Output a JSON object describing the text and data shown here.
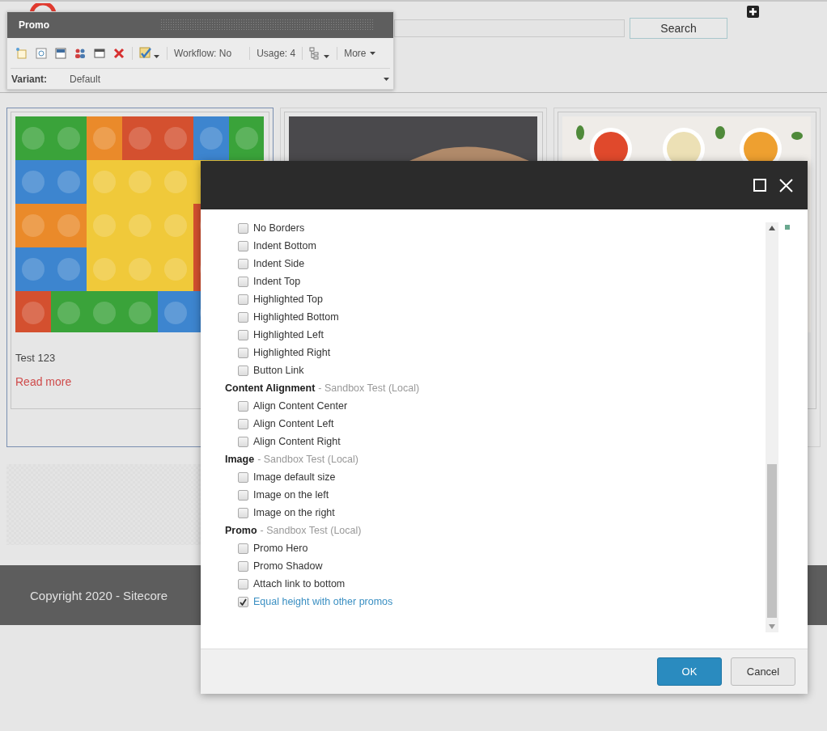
{
  "header": {
    "search_button": "Search"
  },
  "toolbar": {
    "title": "Promo",
    "workflow": "Workflow: No",
    "usage": "Usage: 4",
    "more": "More",
    "variant_label": "Variant:",
    "variant_value": "Default"
  },
  "cards": [
    {
      "kind": "lego",
      "text": "Test 123",
      "link": "Read more",
      "selected": true
    },
    {
      "kind": "dark",
      "selected": false
    },
    {
      "kind": "soups",
      "selected": false
    }
  ],
  "footer": {
    "copyright": "Copyright 2020 - Sitecore"
  },
  "dialog": {
    "groups": [
      {
        "options": [
          {
            "label": "No Borders",
            "checked": false
          },
          {
            "label": "Indent Bottom",
            "checked": false
          },
          {
            "label": "Indent Side",
            "checked": false
          },
          {
            "label": "Indent Top",
            "checked": false
          },
          {
            "label": "Highlighted Top",
            "checked": false
          },
          {
            "label": "Highlighted Bottom",
            "checked": false
          },
          {
            "label": "Highlighted Left",
            "checked": false
          },
          {
            "label": "Highlighted Right",
            "checked": false
          },
          {
            "label": "Button Link",
            "checked": false
          }
        ]
      },
      {
        "title": "Content Alignment",
        "source": "- Sandbox Test (Local)",
        "options": [
          {
            "label": "Align Content Center",
            "checked": false
          },
          {
            "label": "Align Content Left",
            "checked": false
          },
          {
            "label": "Align Content Right",
            "checked": false
          }
        ]
      },
      {
        "title": "Image",
        "source": "- Sandbox Test (Local)",
        "options": [
          {
            "label": "Image default size",
            "checked": false
          },
          {
            "label": "Image on the left",
            "checked": false
          },
          {
            "label": "Image on the right",
            "checked": false
          }
        ]
      },
      {
        "title": "Promo",
        "source": "- Sandbox Test (Local)",
        "options": [
          {
            "label": "Promo Hero",
            "checked": false
          },
          {
            "label": "Promo Shadow",
            "checked": false
          },
          {
            "label": "Attach link to bottom",
            "checked": false
          },
          {
            "label": "Equal height with other promos",
            "checked": true
          }
        ]
      }
    ],
    "ok": "OK",
    "cancel": "Cancel"
  }
}
